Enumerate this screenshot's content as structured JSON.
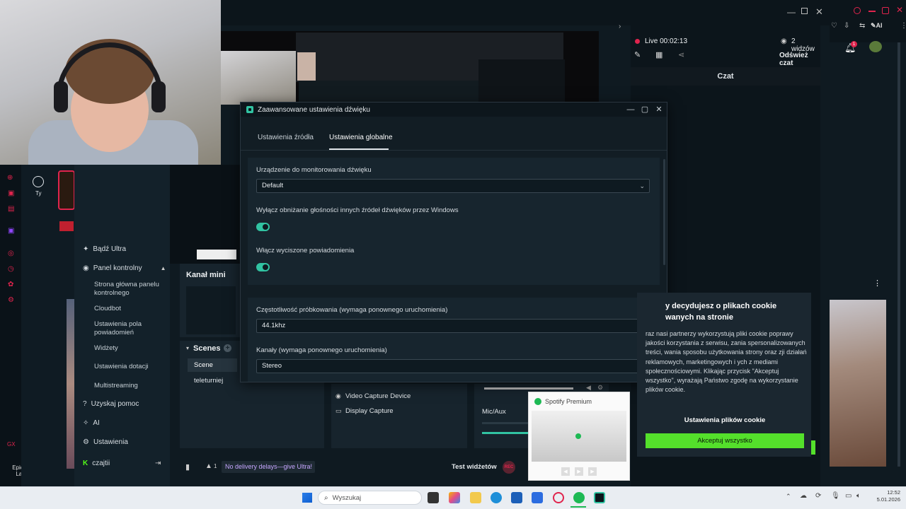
{
  "stream": {
    "live_label": "Live 00:02:13",
    "viewers": "2 widzów",
    "refresh_chat": "Odśwież czat",
    "chat_title": "Czat",
    "notif_count": "1"
  },
  "sidebar": {
    "profile_label": "Ty",
    "items": [
      {
        "label": "Bądź Ultra"
      },
      {
        "label": "Panel kontrolny"
      },
      {
        "label": "Strona główna panelu kontrolnego"
      },
      {
        "label": "Cloudbot"
      },
      {
        "label": "Ustawienia pola powiadomień"
      },
      {
        "label": "Widżety"
      },
      {
        "label": "Ustawienia dotacji"
      },
      {
        "label": "Multistreaming"
      },
      {
        "label": "Uzyskaj pomoc"
      },
      {
        "label": "AI"
      },
      {
        "label": "Ustawienia"
      },
      {
        "label": "czajtii"
      }
    ]
  },
  "dock": {
    "mini_channel": "Kanał mini",
    "scenes_title": "Scenes",
    "scenes": [
      "Scene",
      "teleturniej"
    ],
    "sources": [
      "Video Capture Device",
      "Display Capture"
    ],
    "mixer_label": "Mic/Aux",
    "promo": "No delivery delays—give Ultra!",
    "test_widgets": "Test widżetów",
    "alert_count": "1"
  },
  "epic_label": "Epic Games Launcher",
  "dialog": {
    "title": "Zaawansowane ustawienia dźwięku",
    "tabs": [
      "Ustawienia źródła",
      "Ustawienia globalne"
    ],
    "monitor_label": "Urządzenie do monitorowania dźwięku",
    "monitor_value": "Default",
    "ducking_label": "Wyłącz obniżanie głośności innych źródeł dźwięków przez Windows",
    "ducking_on": true,
    "muted_notif_label": "Włącz wyciszone powiadomienia",
    "muted_notif_on": true,
    "sample_rate_label": "Częstotliwość próbkowania (wymaga ponownego uruchomienia)",
    "sample_rate_value": "44.1khz",
    "channels_label": "Kanały (wymaga ponownego uruchomienia)",
    "channels_value": "Stereo"
  },
  "cookie": {
    "title": "y decydujesz o plikach cookie wanych na stronie",
    "body": "raz nasi partnerzy wykorzystują pliki cookie poprawy jakości korzystania z serwisu, zania spersonalizowanych treści, wania sposobu użytkowania strony oraz zji działań reklamowych, marketingowych i ych z mediami społecznościowymi. Klikając przycisk \"Akceptuj wszystko\", wyrażają Państwo zgodę na wykorzystanie plików cookie.",
    "settings_button": "Ustawienia plików cookie",
    "accept_button": "Akceptuj wszystko"
  },
  "spotify": {
    "title": "Spotify Premium"
  },
  "taskbar": {
    "search_placeholder": "Wyszukaj",
    "time": "12:52",
    "date": "5.01.2026"
  },
  "colors": {
    "accent": "#31c3a2",
    "cookie_accept": "#54e02b",
    "live_red": "#e0244d"
  }
}
